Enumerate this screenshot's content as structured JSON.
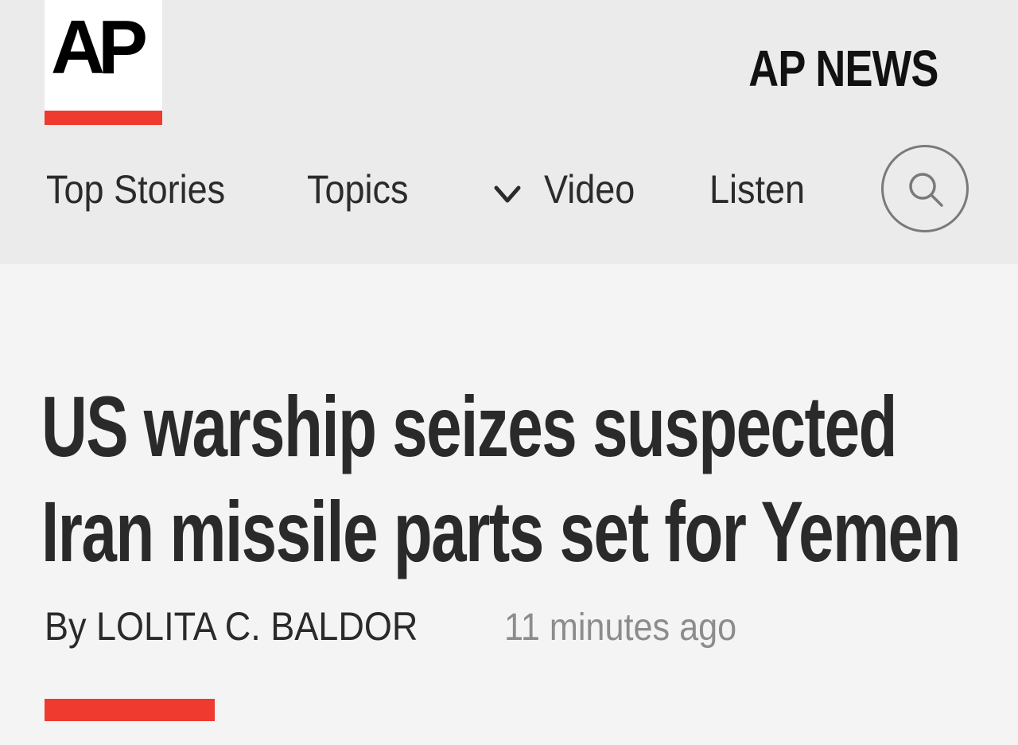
{
  "header": {
    "logo_text": "AP",
    "brand_title": "AP NEWS",
    "accent_color": "#ef3a2f"
  },
  "nav": {
    "items": [
      {
        "label": "Top Stories"
      },
      {
        "label": "Topics",
        "icon": "chevron-down-icon"
      },
      {
        "label": "Video"
      },
      {
        "label": "Listen"
      }
    ],
    "search_icon": "search-icon"
  },
  "article": {
    "headline_lines": [
      "US warship seizes suspected",
      "Iran missile parts set for Yemen"
    ],
    "byline": "By LOLITA C. BALDOR",
    "timestamp": "11 minutes ago"
  }
}
